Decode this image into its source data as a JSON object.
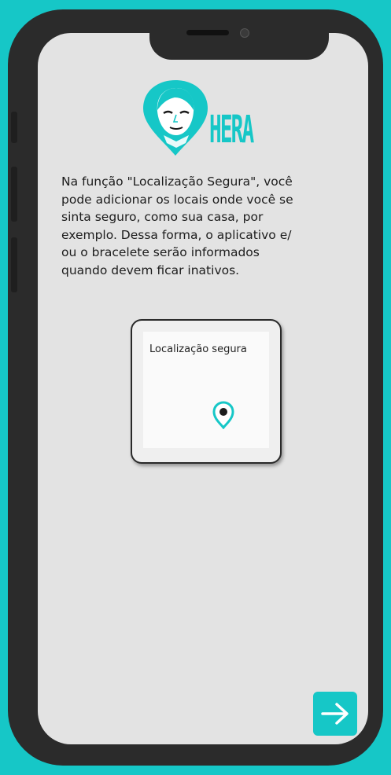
{
  "app": {
    "brand_name": "HERA"
  },
  "icons": {
    "logo": "woman-face-location-pin-icon",
    "location": "location-pin-icon",
    "next": "arrow-right-icon"
  },
  "intro": {
    "lines": [
      "Na função \"Localização Segura\", você",
      "pode adicionar os locais onde você se",
      "sinta seguro, como sua casa, por",
      "exemplo. Dessa forma, o aplicativo e/",
      "ou o bracelete serão informados",
      "quando devem ficar inativos."
    ]
  },
  "card": {
    "label": "Localização segura"
  },
  "colors": {
    "accent": "#16c7c7",
    "screen": "#e3e3e3",
    "frame": "#2b2b2b"
  }
}
